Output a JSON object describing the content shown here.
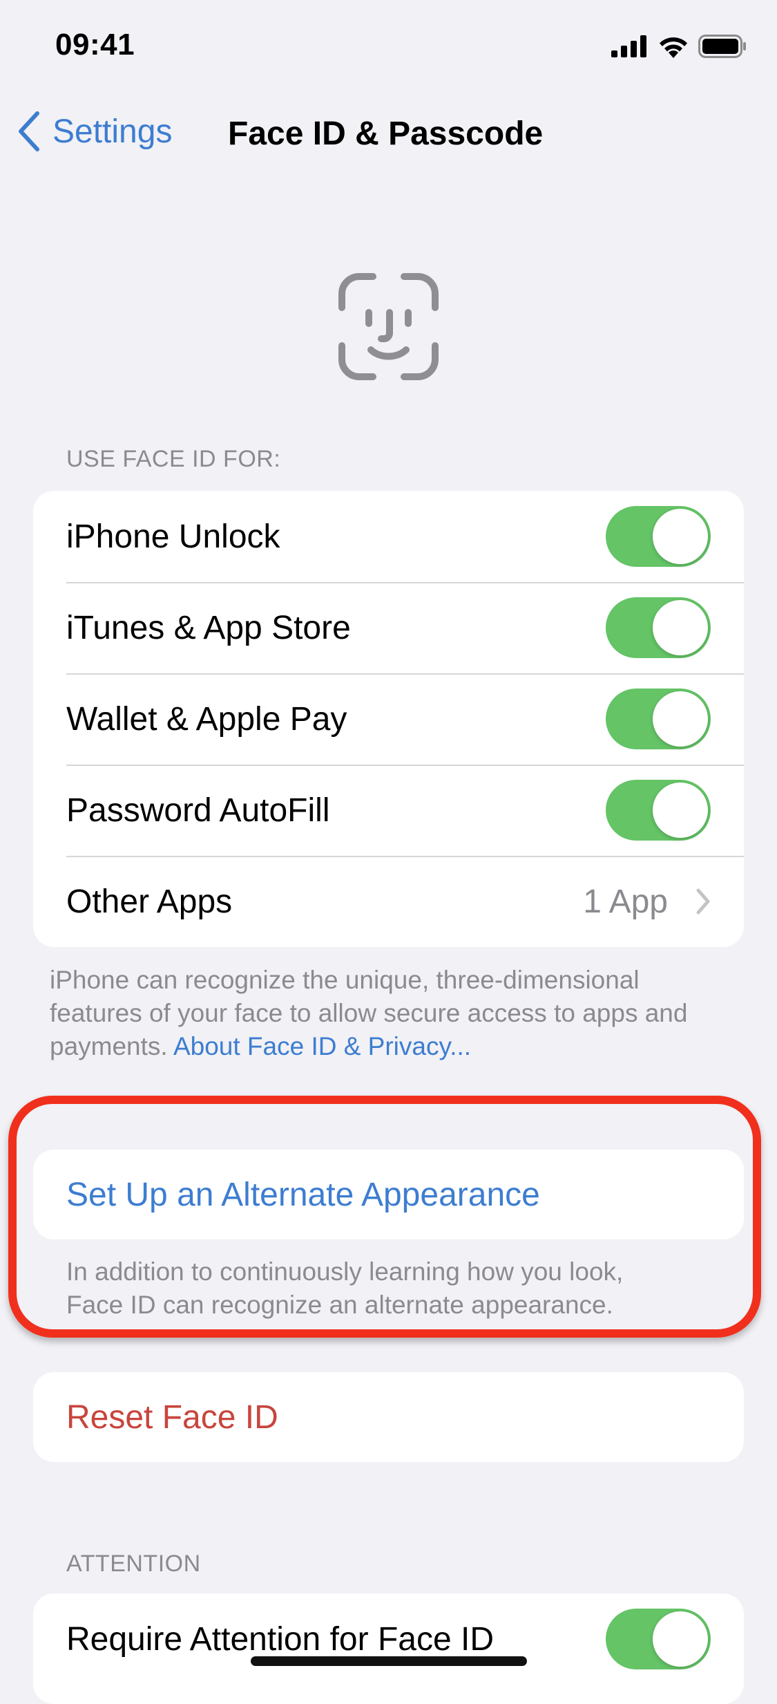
{
  "status_bar": {
    "time": "09:41",
    "icons": [
      "cellular-signal-icon",
      "wifi-icon",
      "battery-icon"
    ]
  },
  "nav": {
    "back_label": "Settings",
    "back_icon": "chevron-left-icon",
    "title": "Face ID & Passcode"
  },
  "hero_icon": "face-id-icon",
  "use_face_id": {
    "header": "USE FACE ID FOR:",
    "rows": [
      {
        "label": "iPhone Unlock",
        "toggle": true
      },
      {
        "label": "iTunes & App Store",
        "toggle": true
      },
      {
        "label": "Wallet & Apple Pay",
        "toggle": true
      },
      {
        "label": "Password AutoFill",
        "toggle": true
      },
      {
        "label": "Other Apps",
        "value": "1 App",
        "disclosure": "chevron-right-icon"
      }
    ],
    "footer_text": "iPhone can recognize the unique, three-dimensional features of your face to allow secure access to apps and payments. ",
    "footer_link": "About Face ID & Privacy..."
  },
  "alternate_appearance": {
    "label": "Set Up an Alternate Appearance",
    "description_line1": "In addition to continuously learning how you look,",
    "description_line2": "Face ID can recognize an alternate appearance.",
    "highlighted": true,
    "highlight_color": "#f0301c"
  },
  "reset": {
    "label": "Reset Face ID"
  },
  "attention": {
    "header": "ATTENTION",
    "rows": [
      {
        "label": "Require Attention for Face ID",
        "toggle": true
      }
    ]
  },
  "colors": {
    "accent": "#3d7dd0",
    "toggle_on": "#64c466",
    "destructive": "#c8453d",
    "background": "#f1f1f6",
    "secondary_text": "#8a8a8f"
  }
}
